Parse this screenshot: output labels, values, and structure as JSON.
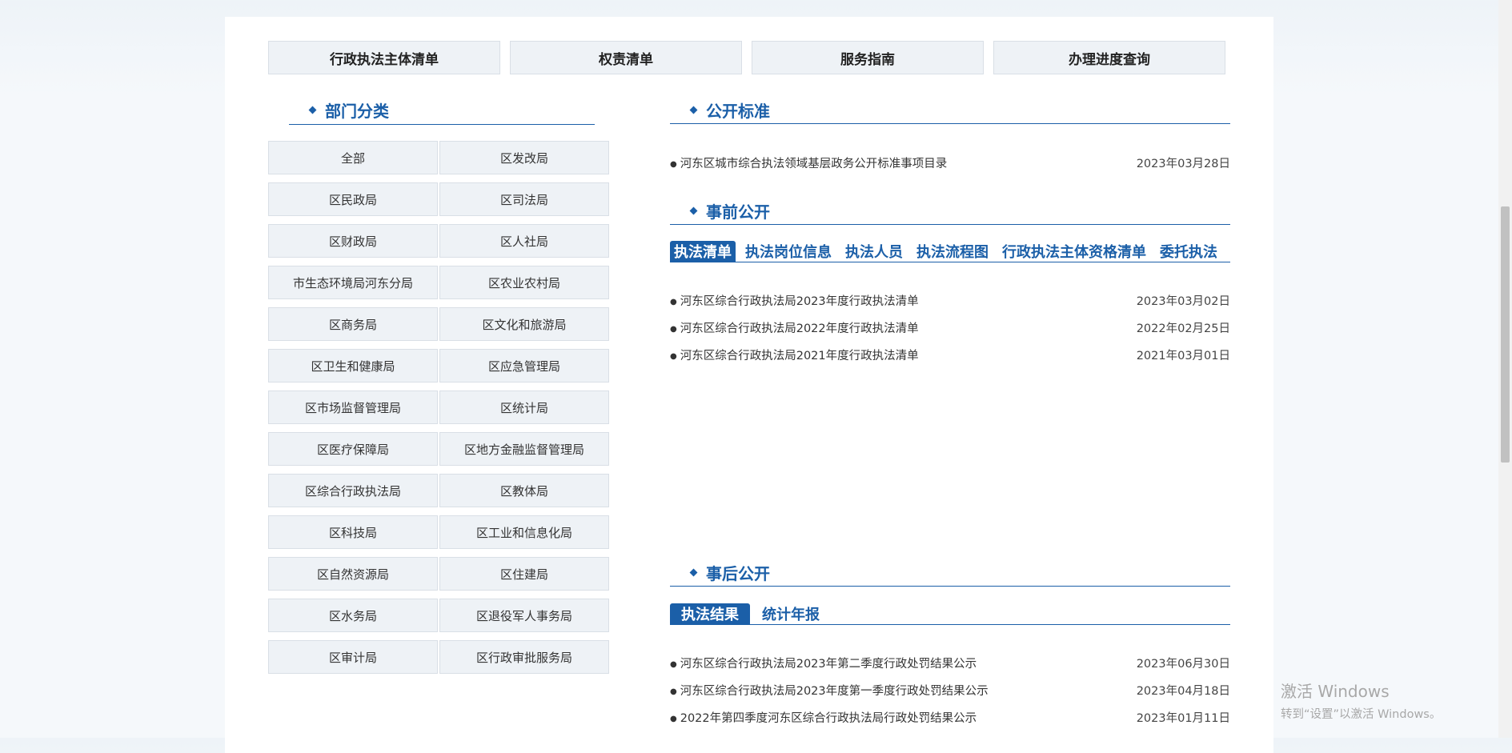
{
  "topnav": [
    "行政执法主体清单",
    "权责清单",
    "服务指南",
    "办理进度查询"
  ],
  "dept": {
    "title": "部门分类",
    "items": [
      "全部",
      "区发改局",
      "区民政局",
      "区司法局",
      "区财政局",
      "区人社局",
      "市生态环境局河东分局",
      "区农业农村局",
      "区商务局",
      "区文化和旅游局",
      "区卫生和健康局",
      "区应急管理局",
      "区市场监督管理局",
      "区统计局",
      "区医疗保障局",
      "区地方金融监督管理局",
      "区综合行政执法局",
      "区教体局",
      "区科技局",
      "区工业和信息化局",
      "区自然资源局",
      "区住建局",
      "区水务局",
      "区退役军人事务局",
      "区审计局",
      "区行政审批服务局"
    ]
  },
  "standard": {
    "title": "公开标准",
    "items": [
      {
        "title": "河东区城市综合执法领域基层政务公开标准事项目录",
        "date": "2023年03月28日"
      }
    ]
  },
  "prior": {
    "title": "事前公开",
    "tabs": [
      "执法清单",
      "执法岗位信息",
      "执法人员",
      "执法流程图",
      "行政执法主体资格清单",
      "委托执法"
    ],
    "items": [
      {
        "title": "河东区综合行政执法局2023年度行政执法清单",
        "date": "2023年03月02日"
      },
      {
        "title": "河东区综合行政执法局2022年度行政执法清单",
        "date": "2022年02月25日"
      },
      {
        "title": "河东区综合行政执法局2021年度行政执法清单",
        "date": "2021年03月01日"
      }
    ]
  },
  "post": {
    "title": "事后公开",
    "tabs": [
      "执法结果",
      "统计年报"
    ],
    "items": [
      {
        "title": "河东区综合行政执法局2023年第二季度行政处罚结果公示",
        "date": "2023年06月30日"
      },
      {
        "title": "河东区综合行政执法局2023年度第一季度行政处罚结果公示",
        "date": "2023年04月18日"
      },
      {
        "title": "2022年第四季度河东区综合行政执法局行政处罚结果公示",
        "date": "2023年01月11日"
      }
    ]
  },
  "watermark": {
    "line1": "激活 Windows",
    "line2": "转到“设置”以激活 Windows。"
  }
}
